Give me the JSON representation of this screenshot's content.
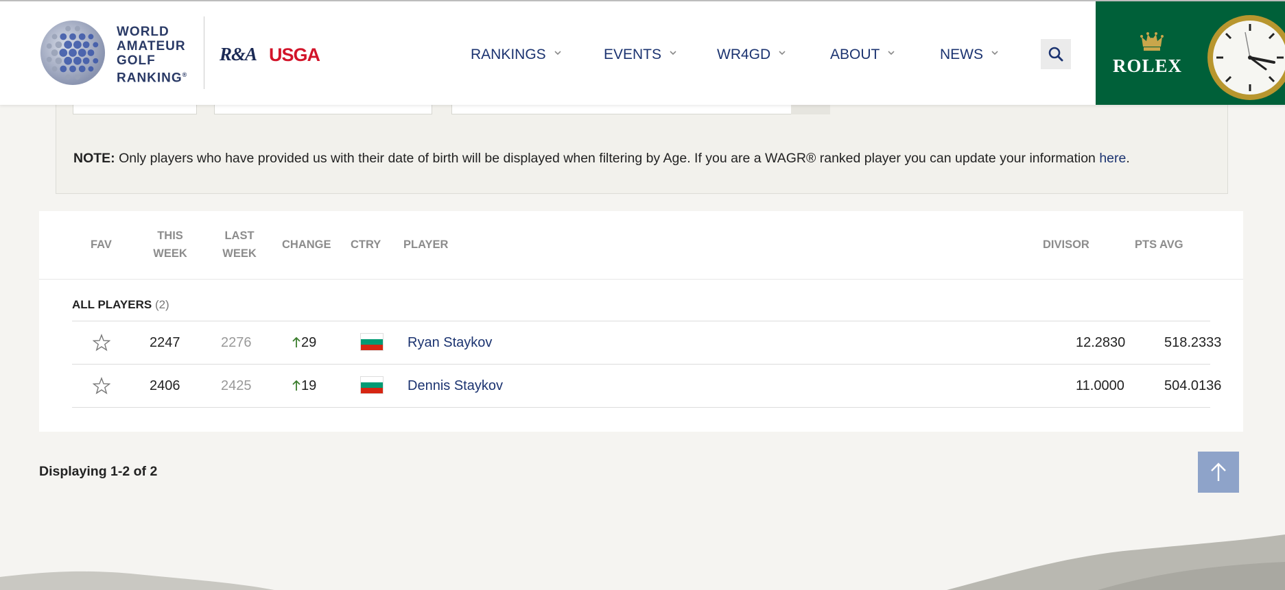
{
  "header": {
    "logo_lines": [
      "WORLD",
      "AMATEUR",
      "GOLF",
      "RANKING"
    ],
    "logo_reg": "®",
    "partner1": "R&A",
    "partner2": "USGA",
    "sponsor": "ROLEX",
    "nav": [
      {
        "label": "RANKINGS"
      },
      {
        "label": "EVENTS"
      },
      {
        "label": "WR4GD"
      },
      {
        "label": "ABOUT"
      },
      {
        "label": "NEWS"
      }
    ],
    "search_icon": "search-icon",
    "colors": {
      "nav": "#1b3370",
      "rolex_green": "#006039"
    }
  },
  "note": {
    "label": "NOTE:",
    "text": " Only players who have provided us with their date of birth will be displayed when filtering by Age. If you are a WAGR® ranked player you can update your information ",
    "link": "here",
    "end": "."
  },
  "table": {
    "headers": {
      "fav": "FAV",
      "this_week_1": "THIS",
      "this_week_2": "WEEK",
      "last_week_1": "LAST",
      "last_week_2": "WEEK",
      "change": "CHANGE",
      "ctry": "CTRY",
      "player": "PLAYER",
      "divisor": "DIVISOR",
      "pts_avg": "PTS AVG"
    },
    "group_label": "ALL PLAYERS",
    "group_count": "(2)",
    "rows": [
      {
        "this_week": "2247",
        "last_week": "2276",
        "change": "29",
        "country": "Bulgaria",
        "player": "Ryan Staykov",
        "divisor": "12.2830",
        "pts_avg": "518.2333"
      },
      {
        "this_week": "2406",
        "last_week": "2425",
        "change": "19",
        "country": "Bulgaria",
        "player": "Dennis Staykov",
        "divisor": "11.0000",
        "pts_avg": "504.0136"
      }
    ]
  },
  "footer": {
    "displaying": "Displaying 1-2 of 2",
    "back_to_top_icon": "arrow-up-icon"
  }
}
